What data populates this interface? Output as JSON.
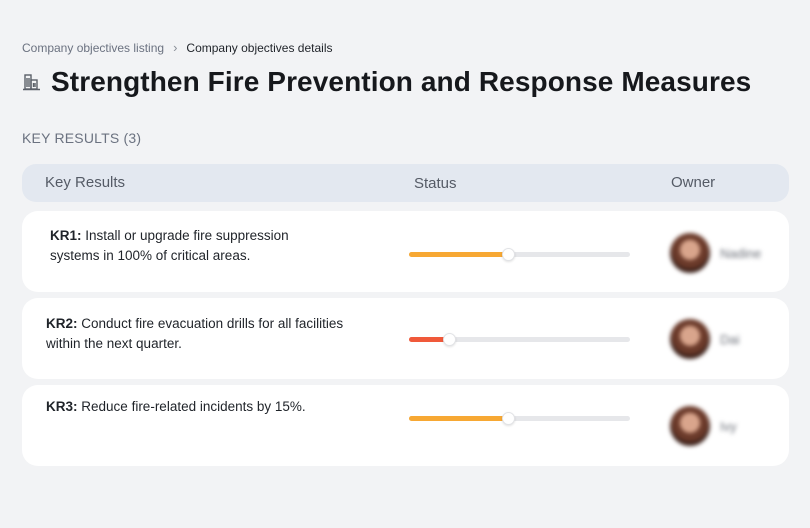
{
  "breadcrumb": {
    "parent": "Company objectives listing",
    "separator": "›",
    "current": "Company objectives details"
  },
  "page": {
    "title_icon": "building-icon",
    "title": "Strengthen Fire Prevention and Response Measures"
  },
  "section": {
    "label": "KEY RESULTS (3)"
  },
  "table": {
    "columns": [
      "Key Results",
      "Status",
      "Owner"
    ]
  },
  "key_results": [
    {
      "key": "KR1:",
      "text": "Install or upgrade fire suppression systems in 100% of critical areas.",
      "progress": 0.45,
      "color": "#f7a833",
      "owner": "Nadine"
    },
    {
      "key": "KR2:",
      "text": "Conduct fire evacuation drills for all facilities within the next quarter.",
      "progress": 0.18,
      "color": "#f0593a",
      "owner": "Dai"
    },
    {
      "key": "KR3:",
      "text": "Reduce fire-related incidents by 15%.",
      "progress": 0.45,
      "color": "#f7a833",
      "owner": "Ivy"
    }
  ]
}
